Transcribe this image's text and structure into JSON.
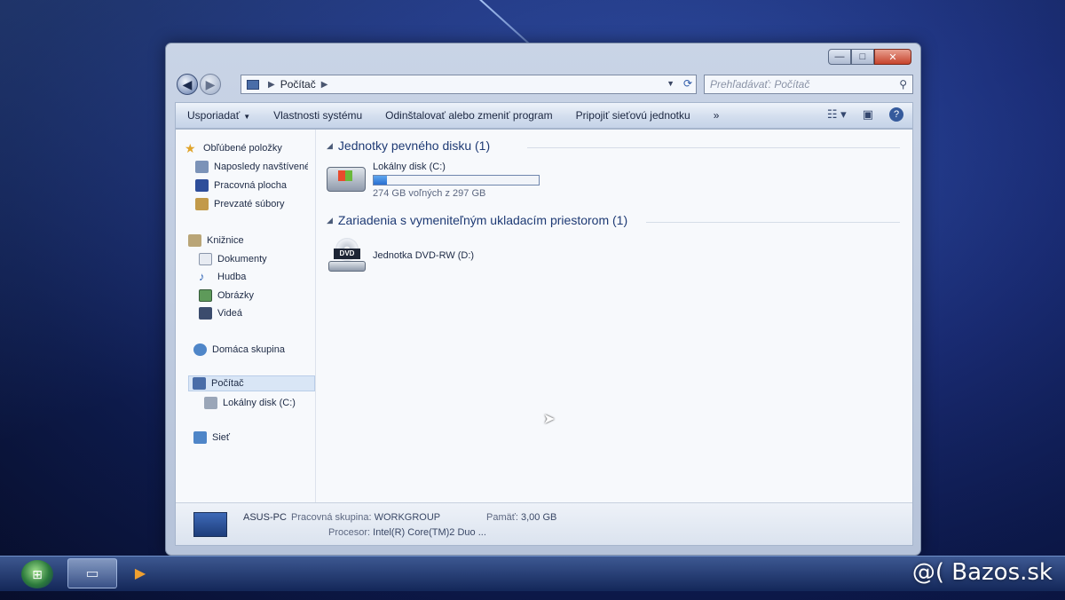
{
  "window": {
    "caption": {
      "minimize": "—",
      "maximize": "□",
      "close": "✕"
    }
  },
  "address": {
    "path": [
      "Počítač"
    ],
    "search_placeholder": "Prehľadávať: Počítač"
  },
  "toolbar": {
    "organize": "Usporiadať",
    "system_properties": "Vlastnosti systému",
    "uninstall": "Odinštalovať alebo zmeniť program",
    "map_drive": "Pripojiť sieťovú jednotku",
    "more": "»"
  },
  "sidebar": {
    "favorites": {
      "header": "Obľúbené položky",
      "items": [
        "Naposledy navštívené",
        "Pracovná plocha",
        "Prevzaté súbory"
      ]
    },
    "libraries": {
      "header": "Knižnice",
      "items": [
        "Dokumenty",
        "Hudba",
        "Obrázky",
        "Videá"
      ]
    },
    "homegroup": "Domáca skupina",
    "computer": {
      "header": "Počítač",
      "items": [
        "Lokálny disk (C:)"
      ]
    },
    "network": "Sieť"
  },
  "main": {
    "hard_disks": {
      "header": "Jednotky pevného disku (1)",
      "drive_name": "Lokálny disk (C:)",
      "drive_space": "274 GB voľných z 297 GB",
      "used_fraction": 0.08
    },
    "removable": {
      "header": "Zariadenia s vymeniteľným ukladacím priestorom (1)",
      "drive_name": "Jednotka DVD-RW (D:)",
      "dvd_badge": "DVD"
    }
  },
  "status": {
    "pc_name": "ASUS-PC",
    "workgroup_label": "Pracovná skupina:",
    "workgroup_value": "WORKGROUP",
    "memory_label": "Pamäť:",
    "memory_value": "3,00 GB",
    "processor_label": "Procesor:",
    "processor_value": "Intel(R) Core(TM)2 Duo ..."
  },
  "watermark": "@( Bazos.sk"
}
